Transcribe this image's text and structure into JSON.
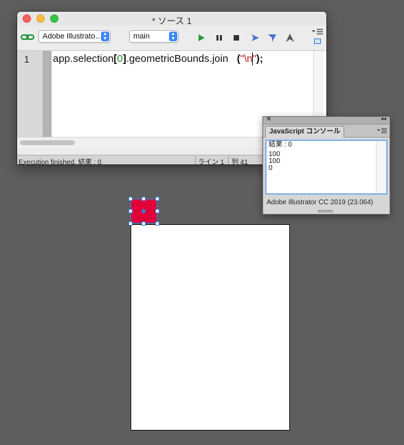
{
  "editor": {
    "title": "* ソース 1",
    "target_select": "Adobe Illustrato…",
    "engine_select": "main",
    "line_number": "1",
    "code": {
      "part1": "app.selection",
      "bracket_open": "[",
      "index": "0",
      "bracket_close": "]",
      "part2": ".geometricBounds.join",
      "spacing": "   ",
      "paren_open": "(",
      "string": "\"\\n\"",
      "paren_close": ");"
    },
    "status": {
      "message": "Execution finished. 結果 : 0",
      "line": "ライン 1",
      "column": "列 41"
    }
  },
  "console": {
    "tab_label": "JavaScript コンソール",
    "output_lines": [
      "結果 : 0",
      "100",
      "100",
      "0"
    ],
    "footer": "Adobe Illustrator CC 2019 (23.064)"
  },
  "colors": {
    "selected_rect_fill": "#e0003a",
    "selection_color": "#3b7dd8"
  },
  "icons": {
    "link": "link-icon",
    "run": "play-icon",
    "pause": "pause-icon",
    "stop": "stop-icon",
    "step_over": "step-over-icon",
    "step_into": "step-into-icon",
    "step_out": "step-out-icon",
    "panel_menu": "panel-menu-icon"
  }
}
